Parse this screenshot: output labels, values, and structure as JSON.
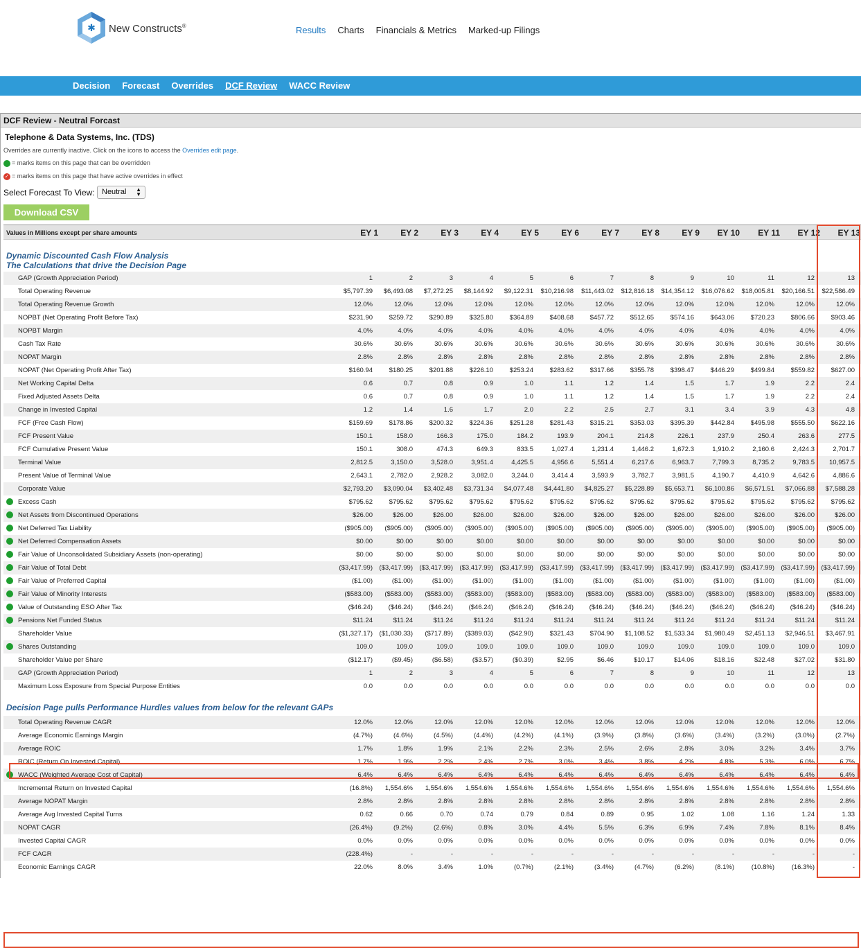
{
  "brand": {
    "name": "New Constructs",
    "reg": "®"
  },
  "top_nav": [
    "Results",
    "Charts",
    "Financials & Metrics",
    "Marked-up Filings"
  ],
  "top_nav_active": 0,
  "sub_nav": [
    "Decision",
    "Forecast",
    "Overrides",
    "DCF Review",
    "WACC Review"
  ],
  "sub_nav_active": 3,
  "panel_title": "DCF Review - Neutral Forcast",
  "company": "Telephone & Data Systems, Inc. (TDS)",
  "notes": {
    "overrides_prefix": "Overrides are currently inactive. Click on the icons to access the",
    "overrides_link": "Overrides edit page",
    "overrides_suffix": ".",
    "green_legend": "= marks items on this page that can be overridden",
    "red_legend": "= marks items on this page that have active overrides in effect"
  },
  "forecast": {
    "label": "Select Forecast To View:",
    "selected": "Neutral"
  },
  "download_label": "Download CSV",
  "table": {
    "units_label": "Values in Millions except per share amounts",
    "columns": [
      "EY 1",
      "EY 2",
      "EY 3",
      "EY 4",
      "EY 5",
      "EY 6",
      "EY 7",
      "EY 8",
      "EY 9",
      "EY 10",
      "EY 11",
      "EY 12",
      "EY 13"
    ],
    "section1_title": [
      "Dynamic Discounted Cash Flow Analysis",
      "The Calculations that drive the Decision Page"
    ],
    "section1_rows": [
      {
        "label": "GAP (Growth Appreciation Period)",
        "dot": false,
        "values": [
          "1",
          "2",
          "3",
          "4",
          "5",
          "6",
          "7",
          "8",
          "9",
          "10",
          "11",
          "12",
          "13"
        ]
      },
      {
        "label": "Total Operating Revenue",
        "dot": false,
        "values": [
          "$5,797.39",
          "$6,493.08",
          "$7,272.25",
          "$8,144.92",
          "$9,122.31",
          "$10,216.98",
          "$11,443.02",
          "$12,816.18",
          "$14,354.12",
          "$16,076.62",
          "$18,005.81",
          "$20,166.51",
          "$22,586.49"
        ]
      },
      {
        "label": "Total Operating Revenue Growth",
        "dot": false,
        "values": [
          "12.0%",
          "12.0%",
          "12.0%",
          "12.0%",
          "12.0%",
          "12.0%",
          "12.0%",
          "12.0%",
          "12.0%",
          "12.0%",
          "12.0%",
          "12.0%",
          "12.0%"
        ]
      },
      {
        "label": "NOPBT (Net Operating Profit Before Tax)",
        "dot": false,
        "values": [
          "$231.90",
          "$259.72",
          "$290.89",
          "$325.80",
          "$364.89",
          "$408.68",
          "$457.72",
          "$512.65",
          "$574.16",
          "$643.06",
          "$720.23",
          "$806.66",
          "$903.46"
        ]
      },
      {
        "label": "NOPBT Margin",
        "dot": false,
        "values": [
          "4.0%",
          "4.0%",
          "4.0%",
          "4.0%",
          "4.0%",
          "4.0%",
          "4.0%",
          "4.0%",
          "4.0%",
          "4.0%",
          "4.0%",
          "4.0%",
          "4.0%"
        ]
      },
      {
        "label": "Cash Tax Rate",
        "dot": false,
        "values": [
          "30.6%",
          "30.6%",
          "30.6%",
          "30.6%",
          "30.6%",
          "30.6%",
          "30.6%",
          "30.6%",
          "30.6%",
          "30.6%",
          "30.6%",
          "30.6%",
          "30.6%"
        ]
      },
      {
        "label": "NOPAT Margin",
        "dot": false,
        "values": [
          "2.8%",
          "2.8%",
          "2.8%",
          "2.8%",
          "2.8%",
          "2.8%",
          "2.8%",
          "2.8%",
          "2.8%",
          "2.8%",
          "2.8%",
          "2.8%",
          "2.8%"
        ]
      },
      {
        "label": "NOPAT (Net Operating Profit After Tax)",
        "dot": false,
        "values": [
          "$160.94",
          "$180.25",
          "$201.88",
          "$226.10",
          "$253.24",
          "$283.62",
          "$317.66",
          "$355.78",
          "$398.47",
          "$446.29",
          "$499.84",
          "$559.82",
          "$627.00"
        ]
      },
      {
        "label": "Net Working Capital Delta",
        "dot": false,
        "values": [
          "0.6",
          "0.7",
          "0.8",
          "0.9",
          "1.0",
          "1.1",
          "1.2",
          "1.4",
          "1.5",
          "1.7",
          "1.9",
          "2.2",
          "2.4"
        ]
      },
      {
        "label": "Fixed Adjusted Assets Delta",
        "dot": false,
        "values": [
          "0.6",
          "0.7",
          "0.8",
          "0.9",
          "1.0",
          "1.1",
          "1.2",
          "1.4",
          "1.5",
          "1.7",
          "1.9",
          "2.2",
          "2.4"
        ]
      },
      {
        "label": "Change in Invested Capital",
        "dot": false,
        "values": [
          "1.2",
          "1.4",
          "1.6",
          "1.7",
          "2.0",
          "2.2",
          "2.5",
          "2.7",
          "3.1",
          "3.4",
          "3.9",
          "4.3",
          "4.8"
        ]
      },
      {
        "label": "FCF (Free Cash Flow)",
        "dot": false,
        "values": [
          "$159.69",
          "$178.86",
          "$200.32",
          "$224.36",
          "$251.28",
          "$281.43",
          "$315.21",
          "$353.03",
          "$395.39",
          "$442.84",
          "$495.98",
          "$555.50",
          "$622.16"
        ]
      },
      {
        "label": "FCF Present Value",
        "dot": false,
        "values": [
          "150.1",
          "158.0",
          "166.3",
          "175.0",
          "184.2",
          "193.9",
          "204.1",
          "214.8",
          "226.1",
          "237.9",
          "250.4",
          "263.6",
          "277.5"
        ]
      },
      {
        "label": "FCF Cumulative Present Value",
        "dot": false,
        "values": [
          "150.1",
          "308.0",
          "474.3",
          "649.3",
          "833.5",
          "1,027.4",
          "1,231.4",
          "1,446.2",
          "1,672.3",
          "1,910.2",
          "2,160.6",
          "2,424.3",
          "2,701.7"
        ]
      },
      {
        "label": "Terminal Value",
        "dot": false,
        "values": [
          "2,812.5",
          "3,150.0",
          "3,528.0",
          "3,951.4",
          "4,425.5",
          "4,956.6",
          "5,551.4",
          "6,217.6",
          "6,963.7",
          "7,799.3",
          "8,735.2",
          "9,783.5",
          "10,957.5"
        ]
      },
      {
        "label": "Present Value of Terminal Value",
        "dot": false,
        "values": [
          "2,643.1",
          "2,782.0",
          "2,928.2",
          "3,082.0",
          "3,244.0",
          "3,414.4",
          "3,593.9",
          "3,782.7",
          "3,981.5",
          "4,190.7",
          "4,410.9",
          "4,642.6",
          "4,886.6"
        ]
      },
      {
        "label": "Corporate Value",
        "dot": false,
        "values": [
          "$2,793.20",
          "$3,090.04",
          "$3,402.48",
          "$3,731.34",
          "$4,077.48",
          "$4,441.80",
          "$4,825.27",
          "$5,228.89",
          "$5,653.71",
          "$6,100.86",
          "$6,571.51",
          "$7,066.88",
          "$7,588.28"
        ]
      },
      {
        "label": "Excess Cash",
        "dot": true,
        "values": [
          "$795.62",
          "$795.62",
          "$795.62",
          "$795.62",
          "$795.62",
          "$795.62",
          "$795.62",
          "$795.62",
          "$795.62",
          "$795.62",
          "$795.62",
          "$795.62",
          "$795.62"
        ]
      },
      {
        "label": "Net Assets from Discontinued Operations",
        "dot": true,
        "values": [
          "$26.00",
          "$26.00",
          "$26.00",
          "$26.00",
          "$26.00",
          "$26.00",
          "$26.00",
          "$26.00",
          "$26.00",
          "$26.00",
          "$26.00",
          "$26.00",
          "$26.00"
        ]
      },
      {
        "label": "Net Deferred Tax Liability",
        "dot": true,
        "values": [
          "($905.00)",
          "($905.00)",
          "($905.00)",
          "($905.00)",
          "($905.00)",
          "($905.00)",
          "($905.00)",
          "($905.00)",
          "($905.00)",
          "($905.00)",
          "($905.00)",
          "($905.00)",
          "($905.00)"
        ]
      },
      {
        "label": "Net Deferred Compensation Assets",
        "dot": true,
        "values": [
          "$0.00",
          "$0.00",
          "$0.00",
          "$0.00",
          "$0.00",
          "$0.00",
          "$0.00",
          "$0.00",
          "$0.00",
          "$0.00",
          "$0.00",
          "$0.00",
          "$0.00"
        ]
      },
      {
        "label": "Fair Value of Unconsolidated Subsidiary Assets (non-operating)",
        "dot": true,
        "values": [
          "$0.00",
          "$0.00",
          "$0.00",
          "$0.00",
          "$0.00",
          "$0.00",
          "$0.00",
          "$0.00",
          "$0.00",
          "$0.00",
          "$0.00",
          "$0.00",
          "$0.00"
        ]
      },
      {
        "label": "Fair Value of Total Debt",
        "dot": true,
        "values": [
          "($3,417.99)",
          "($3,417.99)",
          "($3,417.99)",
          "($3,417.99)",
          "($3,417.99)",
          "($3,417.99)",
          "($3,417.99)",
          "($3,417.99)",
          "($3,417.99)",
          "($3,417.99)",
          "($3,417.99)",
          "($3,417.99)",
          "($3,417.99)"
        ]
      },
      {
        "label": "Fair Value of Preferred Capital",
        "dot": true,
        "values": [
          "($1.00)",
          "($1.00)",
          "($1.00)",
          "($1.00)",
          "($1.00)",
          "($1.00)",
          "($1.00)",
          "($1.00)",
          "($1.00)",
          "($1.00)",
          "($1.00)",
          "($1.00)",
          "($1.00)"
        ]
      },
      {
        "label": "Fair Value of Minority Interests",
        "dot": true,
        "values": [
          "($583.00)",
          "($583.00)",
          "($583.00)",
          "($583.00)",
          "($583.00)",
          "($583.00)",
          "($583.00)",
          "($583.00)",
          "($583.00)",
          "($583.00)",
          "($583.00)",
          "($583.00)",
          "($583.00)"
        ]
      },
      {
        "label": "Value of Outstanding ESO After Tax",
        "dot": true,
        "values": [
          "($46.24)",
          "($46.24)",
          "($46.24)",
          "($46.24)",
          "($46.24)",
          "($46.24)",
          "($46.24)",
          "($46.24)",
          "($46.24)",
          "($46.24)",
          "($46.24)",
          "($46.24)",
          "($46.24)"
        ]
      },
      {
        "label": "Pensions Net Funded Status",
        "dot": true,
        "values": [
          "$11.24",
          "$11.24",
          "$11.24",
          "$11.24",
          "$11.24",
          "$11.24",
          "$11.24",
          "$11.24",
          "$11.24",
          "$11.24",
          "$11.24",
          "$11.24",
          "$11.24"
        ]
      },
      {
        "label": "Shareholder Value",
        "dot": false,
        "values": [
          "($1,327.17)",
          "($1,030.33)",
          "($717.89)",
          "($389.03)",
          "($42.90)",
          "$321.43",
          "$704.90",
          "$1,108.52",
          "$1,533.34",
          "$1,980.49",
          "$2,451.13",
          "$2,946.51",
          "$3,467.91"
        ]
      },
      {
        "label": "Shares Outstanding",
        "dot": true,
        "values": [
          "109.0",
          "109.0",
          "109.0",
          "109.0",
          "109.0",
          "109.0",
          "109.0",
          "109.0",
          "109.0",
          "109.0",
          "109.0",
          "109.0",
          "109.0"
        ]
      },
      {
        "label": "Shareholder Value per Share",
        "dot": false,
        "values": [
          "($12.17)",
          "($9.45)",
          "($6.58)",
          "($3.57)",
          "($0.39)",
          "$2.95",
          "$6.46",
          "$10.17",
          "$14.06",
          "$18.16",
          "$22.48",
          "$27.02",
          "$31.80"
        ]
      },
      {
        "label": "GAP (Growth Appreciation Period)",
        "dot": false,
        "values": [
          "1",
          "2",
          "3",
          "4",
          "5",
          "6",
          "7",
          "8",
          "9",
          "10",
          "11",
          "12",
          "13"
        ]
      },
      {
        "label": "Maximum Loss Exposure from Special Purpose Entities",
        "dot": false,
        "values": [
          "0.0",
          "0.0",
          "0.0",
          "0.0",
          "0.0",
          "0.0",
          "0.0",
          "0.0",
          "0.0",
          "0.0",
          "0.0",
          "0.0",
          "0.0"
        ]
      }
    ],
    "section2_title": "Decision Page pulls Performance Hurdles values from below for the relevant GAPs",
    "section2_rows": [
      {
        "label": "Total Operating Revenue CAGR",
        "dot": false,
        "values": [
          "12.0%",
          "12.0%",
          "12.0%",
          "12.0%",
          "12.0%",
          "12.0%",
          "12.0%",
          "12.0%",
          "12.0%",
          "12.0%",
          "12.0%",
          "12.0%",
          "12.0%"
        ]
      },
      {
        "label": "Average Economic Earnings Margin",
        "dot": false,
        "values": [
          "(4.7%)",
          "(4.6%)",
          "(4.5%)",
          "(4.4%)",
          "(4.2%)",
          "(4.1%)",
          "(3.9%)",
          "(3.8%)",
          "(3.6%)",
          "(3.4%)",
          "(3.2%)",
          "(3.0%)",
          "(2.7%)"
        ]
      },
      {
        "label": "Average ROIC",
        "dot": false,
        "values": [
          "1.7%",
          "1.8%",
          "1.9%",
          "2.1%",
          "2.2%",
          "2.3%",
          "2.5%",
          "2.6%",
          "2.8%",
          "3.0%",
          "3.2%",
          "3.4%",
          "3.7%"
        ]
      },
      {
        "label": "ROIC (Return On Invested Capital)",
        "dot": false,
        "values": [
          "1.7%",
          "1.9%",
          "2.2%",
          "2.4%",
          "2.7%",
          "3.0%",
          "3.4%",
          "3.8%",
          "4.2%",
          "4.8%",
          "5.3%",
          "6.0%",
          "6.7%"
        ]
      },
      {
        "label": "WACC (Weighted Average Cost of Capital)",
        "dot": true,
        "values": [
          "6.4%",
          "6.4%",
          "6.4%",
          "6.4%",
          "6.4%",
          "6.4%",
          "6.4%",
          "6.4%",
          "6.4%",
          "6.4%",
          "6.4%",
          "6.4%",
          "6.4%"
        ]
      },
      {
        "label": "Incremental Return on Invested Capital",
        "dot": false,
        "values": [
          "(16.8%)",
          "1,554.6%",
          "1,554.6%",
          "1,554.6%",
          "1,554.6%",
          "1,554.6%",
          "1,554.6%",
          "1,554.6%",
          "1,554.6%",
          "1,554.6%",
          "1,554.6%",
          "1,554.6%",
          "1,554.6%"
        ]
      },
      {
        "label": "Average NOPAT Margin",
        "dot": false,
        "values": [
          "2.8%",
          "2.8%",
          "2.8%",
          "2.8%",
          "2.8%",
          "2.8%",
          "2.8%",
          "2.8%",
          "2.8%",
          "2.8%",
          "2.8%",
          "2.8%",
          "2.8%"
        ]
      },
      {
        "label": "Average Avg Invested Capital Turns",
        "dot": false,
        "values": [
          "0.62",
          "0.66",
          "0.70",
          "0.74",
          "0.79",
          "0.84",
          "0.89",
          "0.95",
          "1.02",
          "1.08",
          "1.16",
          "1.24",
          "1.33"
        ]
      },
      {
        "label": "NOPAT CAGR",
        "dot": false,
        "values": [
          "(26.4%)",
          "(9.2%)",
          "(2.6%)",
          "0.8%",
          "3.0%",
          "4.4%",
          "5.5%",
          "6.3%",
          "6.9%",
          "7.4%",
          "7.8%",
          "8.1%",
          "8.4%"
        ]
      },
      {
        "label": "Invested Capital CAGR",
        "dot": false,
        "values": [
          "0.0%",
          "0.0%",
          "0.0%",
          "0.0%",
          "0.0%",
          "0.0%",
          "0.0%",
          "0.0%",
          "0.0%",
          "0.0%",
          "0.0%",
          "0.0%",
          "0.0%"
        ]
      },
      {
        "label": "FCF CAGR",
        "dot": false,
        "values": [
          "(228.4%)",
          "-",
          "-",
          "-",
          "-",
          "-",
          "-",
          "-",
          "-",
          "-",
          "-",
          "-",
          "-"
        ]
      },
      {
        "label": "Economic Earnings CAGR",
        "dot": false,
        "values": [
          "22.0%",
          "8.0%",
          "3.4%",
          "1.0%",
          "(0.7%)",
          "(2.1%)",
          "(3.4%)",
          "(4.7%)",
          "(6.2%)",
          "(8.1%)",
          "(10.8%)",
          "(16.3%)",
          "-"
        ]
      }
    ]
  }
}
